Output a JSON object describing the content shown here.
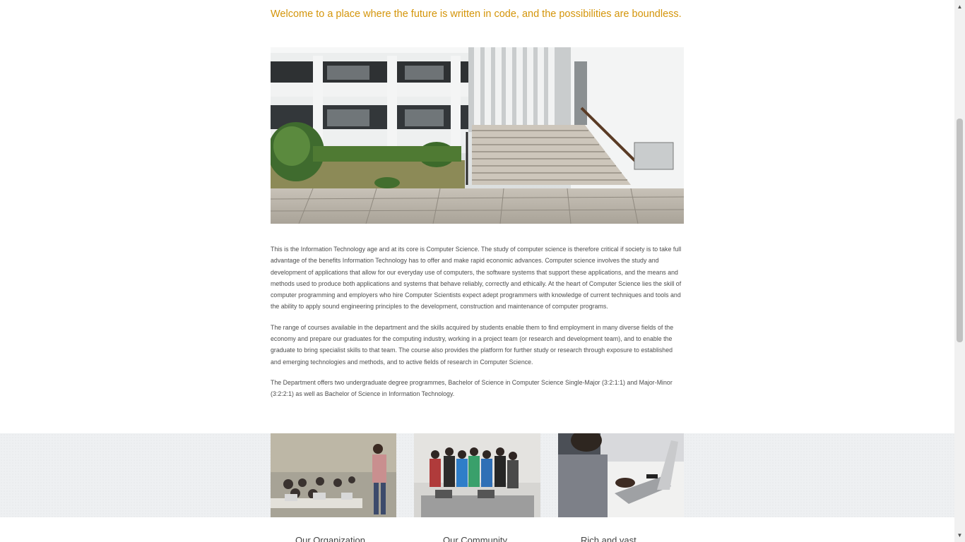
{
  "intro": {
    "tagline": "Welcome to a place where the future is written in code, and the possibilities are boundless."
  },
  "hero_image": {
    "subject": "department building exterior with stairway"
  },
  "body_text": {
    "paragraphs": [
      "This is the Information Technology age and at its core is Computer Science. The study of computer science is therefore critical if society is to take full advantage of the benefits Information Technology has to offer and make rapid economic advances. Computer science involves the study and development of applications that allow for our everyday use of computers, the software systems that support these applications, and the means and methods used to produce both applications and systems that behave reliably, correctly and ethically. At the heart of Computer Science lies the skill of computer programming and employers who hire Computer Scientists expect adept programmers with knowledge of current techniques and tools and the ability to apply sound engineering principles to the development, construction and maintenance of computer programs.",
      "The range of courses available in the department and the skills acquired by students enable them to find employment in many diverse fields of the economy and prepare our graduates for the computing industry, working in a project team (or research and development team), and to enable the graduate to bring specialist skills to that team. The course also provides the platform for further study or research through exposure to established and emerging technologies and methods, and to active fields of research in Computer Science.",
      "The Department offers two undergraduate degree programmes, Bachelor of Science in Computer Science Single-Major (3:2:1:1) and Major-Minor (3:2:2:1) as well as Bachelor of Science in Information Technology."
    ]
  },
  "features": {
    "cards": [
      {
        "image": "lecture-in-classroom",
        "caption": "Our Organization"
      },
      {
        "image": "student-group-photo",
        "caption": "Our Community"
      },
      {
        "image": "student-typing-on-laptop",
        "caption": "Rich and vast"
      }
    ]
  },
  "colors": {
    "tagline": "#d4950a",
    "band": "#eef0f2",
    "text": "#4c4c4c"
  }
}
